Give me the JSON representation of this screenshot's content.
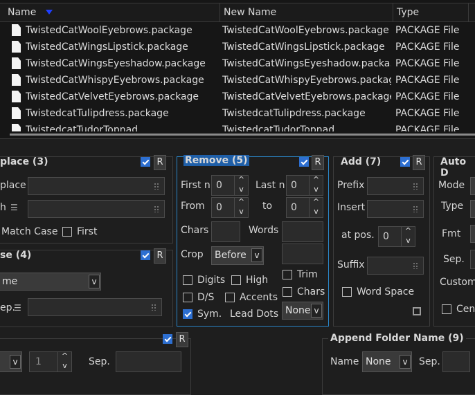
{
  "filelist": {
    "columns": {
      "name": "Name",
      "new_name": "New Name",
      "type": "Type"
    },
    "rows": [
      {
        "name": "TwistedCatWoolEyebrows.package",
        "new_name": "TwistedCatWoolEyebrows.package",
        "type": "PACKAGE File"
      },
      {
        "name": "TwistedCatWingsLipstick.package",
        "new_name": "TwistedCatWingsLipstick.package",
        "type": "PACKAGE File"
      },
      {
        "name": "TwistedCatWingsEyeshadow.package",
        "new_name": "TwistedCatWingsEyeshadow.packa...",
        "type": "PACKAGE File"
      },
      {
        "name": "TwistedCatWhispyEyebrows.package",
        "new_name": "TwistedCatWhispyEyebrows.package",
        "type": "PACKAGE File"
      },
      {
        "name": "TwistedCatVelvetEyebrows.package",
        "new_name": "TwistedCatVelvetEyebrows.package",
        "type": "PACKAGE File"
      },
      {
        "name": "TwistedcatTulipdress.package",
        "new_name": "TwistedcatTulipdress.package",
        "type": "PACKAGE File"
      },
      {
        "name": "TwistedcatTudorTopnad...",
        "new_name": "TwistedcatTudorTopnad...",
        "type": "PACKAGE File"
      }
    ]
  },
  "replace": {
    "title": "place (3)",
    "replace_label": "place",
    "with_label": "h",
    "match_case": "Match Case",
    "first": "First",
    "r": "R"
  },
  "case": {
    "title": "se (4)",
    "combo_value": "me",
    "sep_label": "ep.",
    "r": "R"
  },
  "remove": {
    "title": "Remove (5)",
    "r": "R",
    "first_n": "First n",
    "first_n_val": "0",
    "last_n": "Last n",
    "last_n_val": "0",
    "from": "From",
    "from_val": "0",
    "to": "to",
    "to_val": "0",
    "chars": "Chars",
    "words": "Words",
    "crop": "Crop",
    "crop_val": "Before",
    "digits": "Digits",
    "high": "High",
    "trim": "Trim",
    "ds": "D/S",
    "accents": "Accents",
    "chars2": "Chars",
    "sym": "Sym.",
    "lead_dots": "Lead Dots",
    "lead_dots_val": "None"
  },
  "add": {
    "title": "Add (7)",
    "r": "R",
    "prefix": "Prefix",
    "insert": "Insert",
    "at_pos": "at pos.",
    "at_pos_val": "0",
    "suffix": "Suffix",
    "word_space": "Word Space"
  },
  "autodate": {
    "title": "Auto D",
    "mode": "Mode",
    "type": "Type",
    "fmt": "Fmt",
    "sep": "Sep.",
    "custom": "Custom",
    "cent": "Cent"
  },
  "numbering": {
    "spin_val": "1",
    "sep": "Sep."
  },
  "append": {
    "title": "Append Folder Name (9)",
    "name": "Name",
    "name_val": "None",
    "sep": "Sep."
  }
}
